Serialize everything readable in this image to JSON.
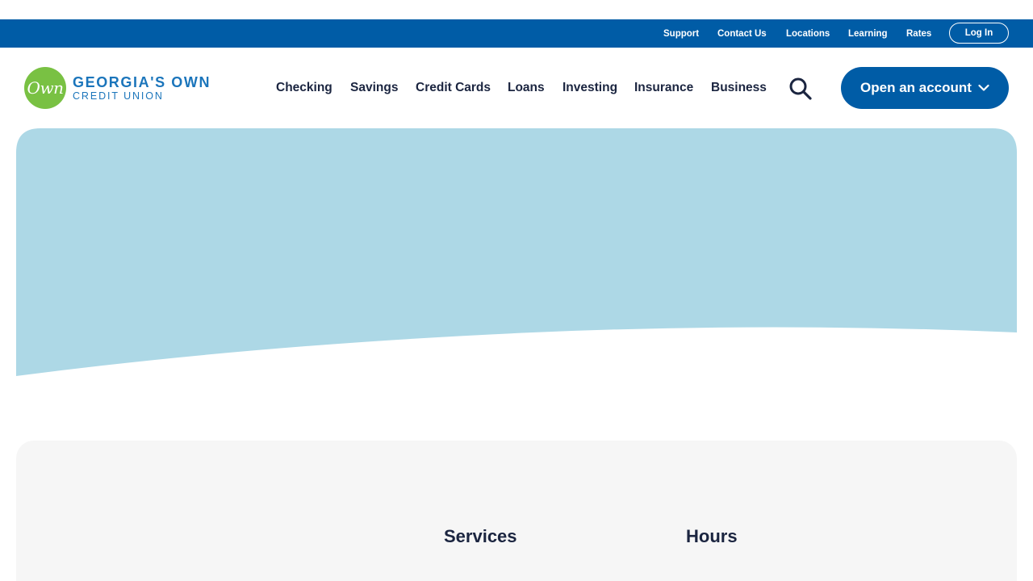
{
  "utility_nav": {
    "links": [
      "Support",
      "Contact Us",
      "Locations",
      "Learning",
      "Rates"
    ],
    "login_label": "Log In"
  },
  "brand": {
    "badge_text": "Own",
    "name_line1": "GEORGIA'S OWN",
    "name_line2": "CREDIT UNION"
  },
  "main_nav": {
    "items": [
      "Checking",
      "Savings",
      "Credit Cards",
      "Loans",
      "Investing",
      "Insurance",
      "Business"
    ],
    "search_icon": "search-icon",
    "open_account_label": "Open an account",
    "open_account_icon": "chevron-down-icon"
  },
  "hero": {
    "color": "#add8e6"
  },
  "info_section": {
    "services_heading": "Services",
    "hours_heading": "Hours"
  },
  "colors": {
    "brand_blue": "#005ca6",
    "logo_green": "#79c143",
    "text_dark": "#1b2540",
    "card_bg": "#f6f6f6"
  }
}
